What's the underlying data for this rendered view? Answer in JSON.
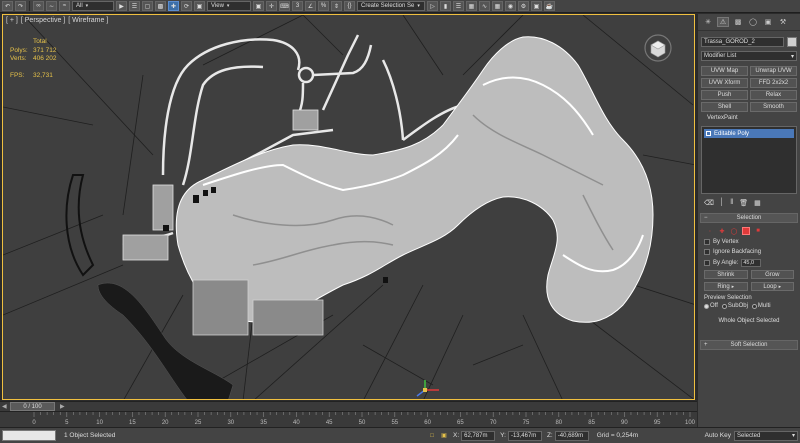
{
  "toolbar": {
    "selection_filter": "All",
    "view_menu": "View",
    "named_selection": "Create Selection Se",
    "icons": [
      "undo-icon",
      "redo-icon",
      "link-icon",
      "unlink-icon",
      "bind-icon",
      "select-icon",
      "select-by-name-icon",
      "rect-select-icon",
      "window-crossing-icon",
      "move-icon",
      "rotate-icon",
      "scale-icon",
      "reference-coords",
      "pivot-icon",
      "select-manipulate-icon",
      "keyboard-shortcut-icon",
      "snap-icon",
      "angle-snap-icon",
      "percent-snap-icon",
      "spinner-snap-icon",
      "edit-named-sel-icon",
      "mirror-icon",
      "align-icon",
      "layer-icon",
      "graphite-icon",
      "curve-editor-icon",
      "schematic-icon",
      "material-editor-icon",
      "render-setup-icon",
      "render-frame-icon",
      "render-icon"
    ]
  },
  "viewport": {
    "label_parts": [
      "[ + ]",
      "[ Perspective ]",
      "[ Wireframe ]"
    ],
    "stats": {
      "header": "Total",
      "polys_label": "Polys:",
      "polys_value": "371 712",
      "verts_label": "Verts:",
      "verts_value": "406 202",
      "fps_label": "FPS:",
      "fps_value": "32,731"
    }
  },
  "command_panel": {
    "tab_icons": [
      "create-tab-icon",
      "modify-tab-icon",
      "hierarchy-tab-icon",
      "motion-tab-icon",
      "display-tab-icon",
      "utilities-tab-icon"
    ],
    "object_name": "Trassa_GOROD_2",
    "modifier_list": "Modifier List",
    "modifier_buttons": [
      "UVW Map",
      "Unwrap UVW",
      "UVW Xform",
      "FFD 2x2x2",
      "Push",
      "Relax",
      "Shell",
      "Smooth"
    ],
    "vertex_paint": "VertexPaint",
    "stack_item": "Editable Poly",
    "selection": {
      "title": "Selection",
      "by_vertex": "By Vertex",
      "ignore_backfacing": "Ignore Backfacing",
      "by_angle": "By Angle:",
      "angle_value": "45,0",
      "shrink": "Shrink",
      "grow": "Grow",
      "ring": "Ring",
      "loop": "Loop",
      "preview_label": "Preview Selection",
      "preview_options": [
        "Off",
        "SubObj",
        "Multi"
      ],
      "whole_object": "Whole Object Selected"
    },
    "soft_selection": "Soft Selection"
  },
  "timeline": {
    "frame_display": "0 / 100",
    "ticks": [
      0,
      5,
      10,
      15,
      20,
      25,
      30,
      35,
      40,
      45,
      50,
      55,
      60,
      65,
      70,
      75,
      80,
      85,
      90,
      95,
      100
    ]
  },
  "status": {
    "selected": "1 Object Selected",
    "x_label": "X:",
    "x_value": "62,787m",
    "y_label": "Y:",
    "y_value": "-13,467m",
    "z_label": "Z:",
    "z_value": "-40,689m",
    "grid": "Grid = 0,254m",
    "auto_key": "Auto Key",
    "auto_key_mode": "Selected"
  },
  "colors": {
    "viewport_bg": "#3f3f3f",
    "active_border": "#f0c040",
    "stats_text": "#e6c24a",
    "stack_highlight": "#4a78b8",
    "subobj_red": "#e03a3a"
  }
}
